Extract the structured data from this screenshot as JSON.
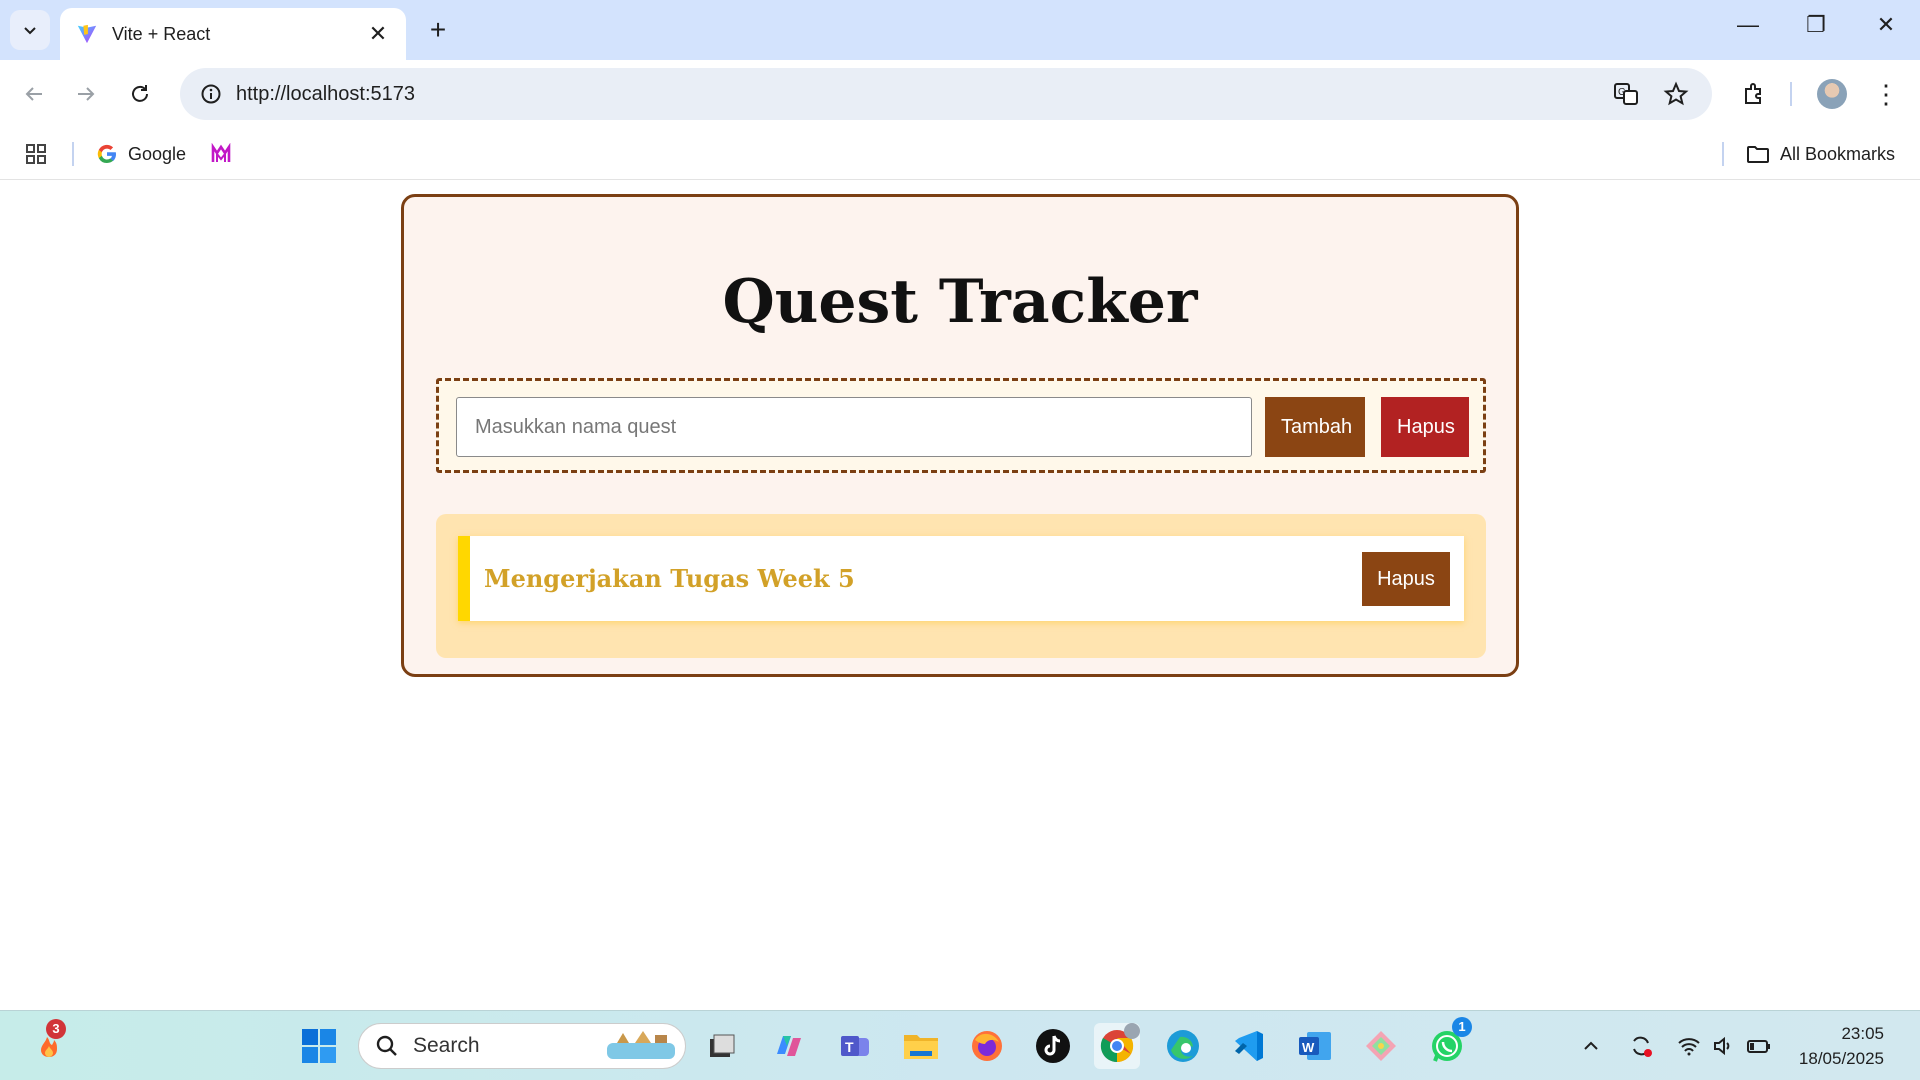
{
  "browser": {
    "tab_title": "Vite + React",
    "url": "http://localhost:5173",
    "bookmarks": [
      {
        "label": "Google"
      },
      {
        "label": ""
      }
    ],
    "all_bookmarks_label": "All Bookmarks"
  },
  "app": {
    "title": "Quest Tracker",
    "input_placeholder": "Masukkan nama quest",
    "input_value": "",
    "add_button": "Tambah",
    "clear_button": "Hapus",
    "quests": [
      {
        "name": "Mengerjakan Tugas Week 5",
        "delete_label": "Hapus"
      }
    ],
    "colors": {
      "card_border": "#7b3f13",
      "card_bg": "#fdf3ee",
      "add_button": "#8b4513",
      "clear_button": "#b22222",
      "list_bg": "#ffe4b0",
      "item_accent": "#ffd700",
      "item_text": "#d2a128"
    }
  },
  "taskbar": {
    "search_label": "Search",
    "widget_badge": "3",
    "whatsapp_badge": "1",
    "time": "23:05",
    "date": "18/05/2025",
    "icons": [
      "start-icon",
      "search-icon",
      "task-view-icon",
      "copilot-icon",
      "teams-icon",
      "file-explorer-icon",
      "firefox-icon",
      "tiktok-icon",
      "chrome-icon",
      "edge-icon",
      "vscode-icon",
      "word-icon",
      "git-icon",
      "whatsapp-icon"
    ]
  }
}
